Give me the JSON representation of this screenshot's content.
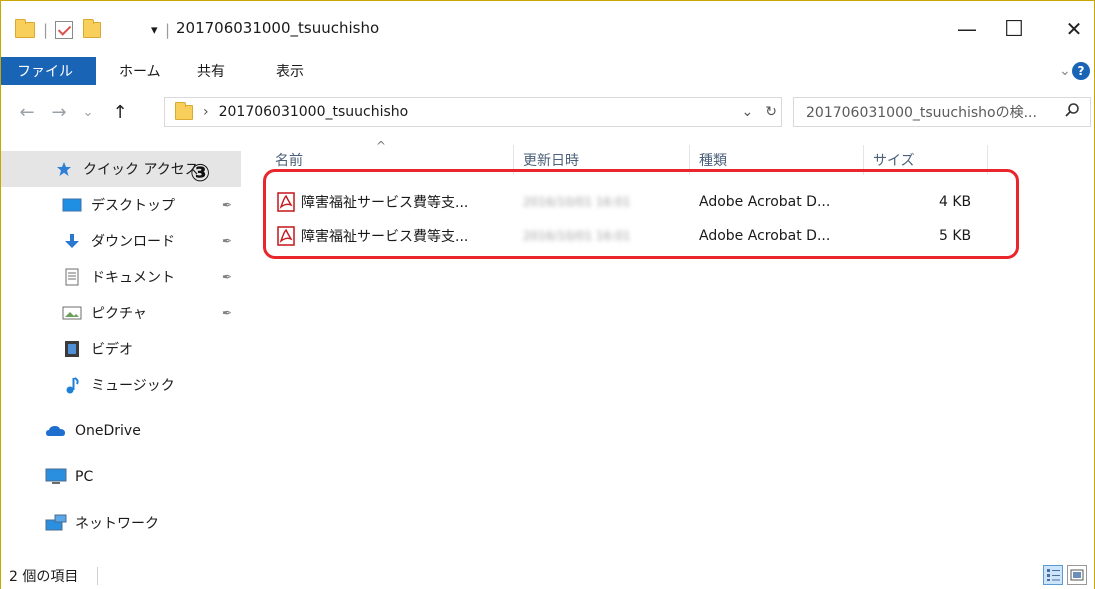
{
  "window": {
    "title": "201706031000_tsuuchisho",
    "minimize_glyph": "—",
    "maximize_glyph": "☐",
    "close_glyph": "✕"
  },
  "quick_access_toolbar": {
    "separator": "|",
    "dropdown_glyph": "▾"
  },
  "ribbon": {
    "tabs": [
      "ファイル",
      "ホーム",
      "共有",
      "表示"
    ],
    "expand_glyph": "⌄",
    "help_glyph": "?"
  },
  "navigation": {
    "back_glyph": "←",
    "forward_glyph": "→",
    "recent_glyph": "⌄",
    "up_glyph": "↑"
  },
  "address": {
    "path_separator": "›",
    "path": "201706031000_tsuuchisho",
    "dropdown_glyph": "⌄",
    "refresh_glyph": "↻"
  },
  "search": {
    "placeholder": "201706031000_tsuuchishoの検...",
    "icon": "search-icon"
  },
  "nav_pane": {
    "annotation": "③",
    "items": [
      {
        "label": "クイック アクセス",
        "icon": "star-icon",
        "pinned": false
      },
      {
        "label": "デスクトップ",
        "icon": "desktop-icon",
        "pinned": true
      },
      {
        "label": "ダウンロード",
        "icon": "download-icon",
        "pinned": true
      },
      {
        "label": "ドキュメント",
        "icon": "document-icon",
        "pinned": true
      },
      {
        "label": "ピクチャ",
        "icon": "pictures-icon",
        "pinned": true
      },
      {
        "label": "ビデオ",
        "icon": "video-icon",
        "pinned": false
      },
      {
        "label": "ミュージック",
        "icon": "music-icon",
        "pinned": false
      },
      {
        "label": "OneDrive",
        "icon": "onedrive-icon",
        "pinned": false
      },
      {
        "label": "PC",
        "icon": "pc-icon",
        "pinned": false
      },
      {
        "label": "ネットワーク",
        "icon": "network-icon",
        "pinned": false
      }
    ]
  },
  "columns": {
    "sort_glyph": "^",
    "name": "名前",
    "modified": "更新日時",
    "type": "種類",
    "size": "サイズ"
  },
  "files": [
    {
      "name": "障害福祉サービス費等支...",
      "modified": "2016/10/01 16:01",
      "type": "Adobe Acrobat D...",
      "size": "4 KB",
      "icon": "pdf-icon"
    },
    {
      "name": "障害福祉サービス費等支...",
      "modified": "2016/10/01 16:01",
      "type": "Adobe Acrobat D...",
      "size": "5 KB",
      "icon": "pdf-icon"
    }
  ],
  "status": {
    "item_count": "2 個の項目"
  },
  "colors": {
    "accent": "#1a64b5",
    "highlight": "#e8262b",
    "folder": "#f7cf5a",
    "pdf": "#c4161c"
  }
}
